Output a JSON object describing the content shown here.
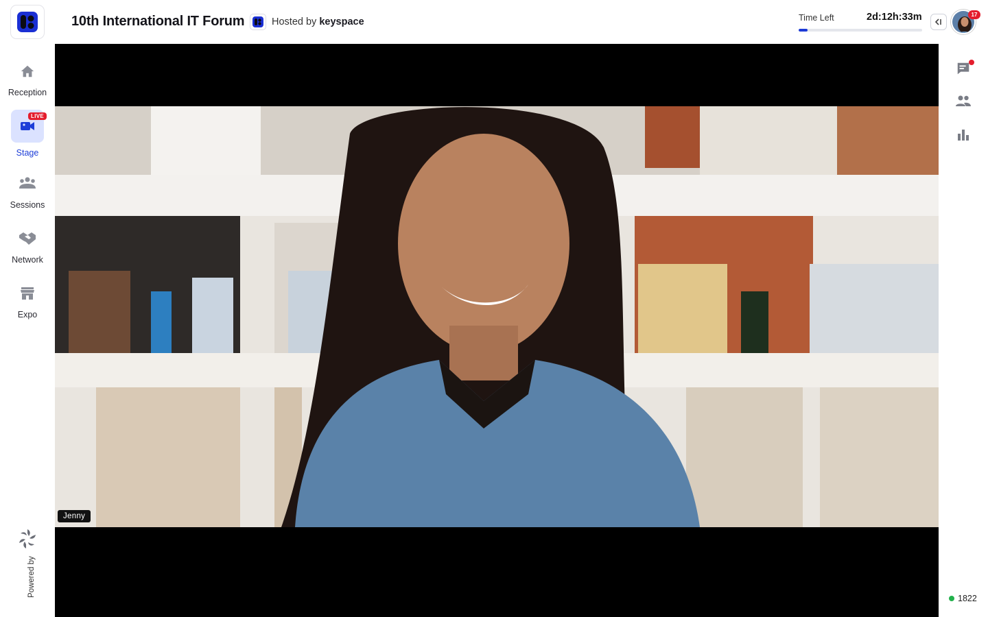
{
  "sidebar": {
    "items": [
      {
        "label": "Reception",
        "icon": "home-icon"
      },
      {
        "label": "Stage",
        "icon": "video-camera-icon",
        "badge": "LIVE",
        "active": true
      },
      {
        "label": "Sessions",
        "icon": "group-icon"
      },
      {
        "label": "Network",
        "icon": "handshake-icon"
      },
      {
        "label": "Expo",
        "icon": "storefront-icon"
      }
    ],
    "powered_by": "Powered by"
  },
  "header": {
    "title": "10th International IT Forum",
    "hosted_prefix": "Hosted by",
    "host_name": "keyspace",
    "time_left_label": "Time Left",
    "time_left_value": "2d:12h:33m",
    "time_progress": 0.07
  },
  "rightrail": {
    "avatar_badge": "17",
    "icons": [
      "chat-icon",
      "people-icon",
      "bar-chart-icon"
    ],
    "online_count": "1822"
  },
  "stage": {
    "speaker_name": "Jenny"
  },
  "colors": {
    "accent": "#1c3ad6",
    "live": "#e41d2d",
    "active_bg": "#dbe2ff",
    "online": "#22b14c"
  }
}
